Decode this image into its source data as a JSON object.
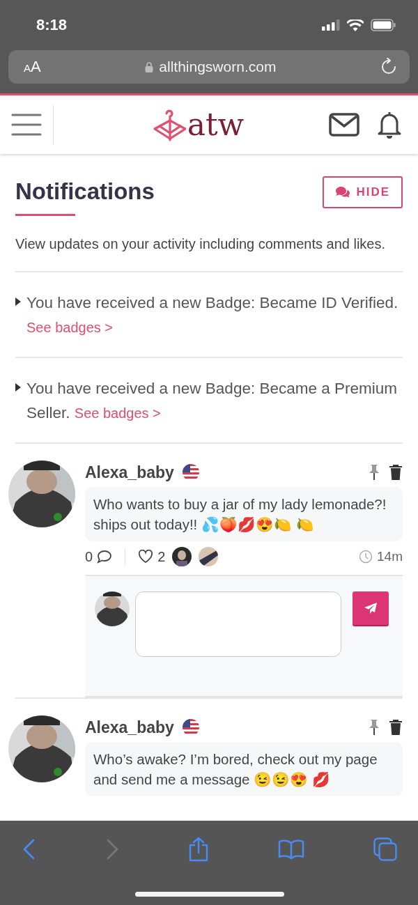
{
  "status_bar": {
    "time": "8:18"
  },
  "browser": {
    "text_size_button": "AA",
    "url": "allthingsworn.com"
  },
  "site_header": {
    "logo": "atw"
  },
  "page": {
    "title": "Notifications",
    "hide_button": "HIDE",
    "description": "View updates on your activity including comments and likes."
  },
  "notifications": [
    {
      "kind": "badge",
      "text": "You have received a new Badge: Became ID Verified.",
      "link": "See badges >"
    },
    {
      "kind": "badge",
      "text": "You have received a new Badge: Became a Premium Seller.",
      "link": "See badges >"
    },
    {
      "kind": "post",
      "user": "Alexa_baby",
      "online": true,
      "text": "Who wants to buy a jar of my lady lemonade?! ships out today!! 💦🍑💋😍🍋 🍋",
      "comments": "0",
      "likes": "2",
      "time": "14m",
      "reply_box": true
    },
    {
      "kind": "post",
      "user": "Alexa_baby",
      "online": true,
      "text": "Who’s awake? I’m bored, check out my page and send me a message 😉😉😍 💋"
    }
  ]
}
